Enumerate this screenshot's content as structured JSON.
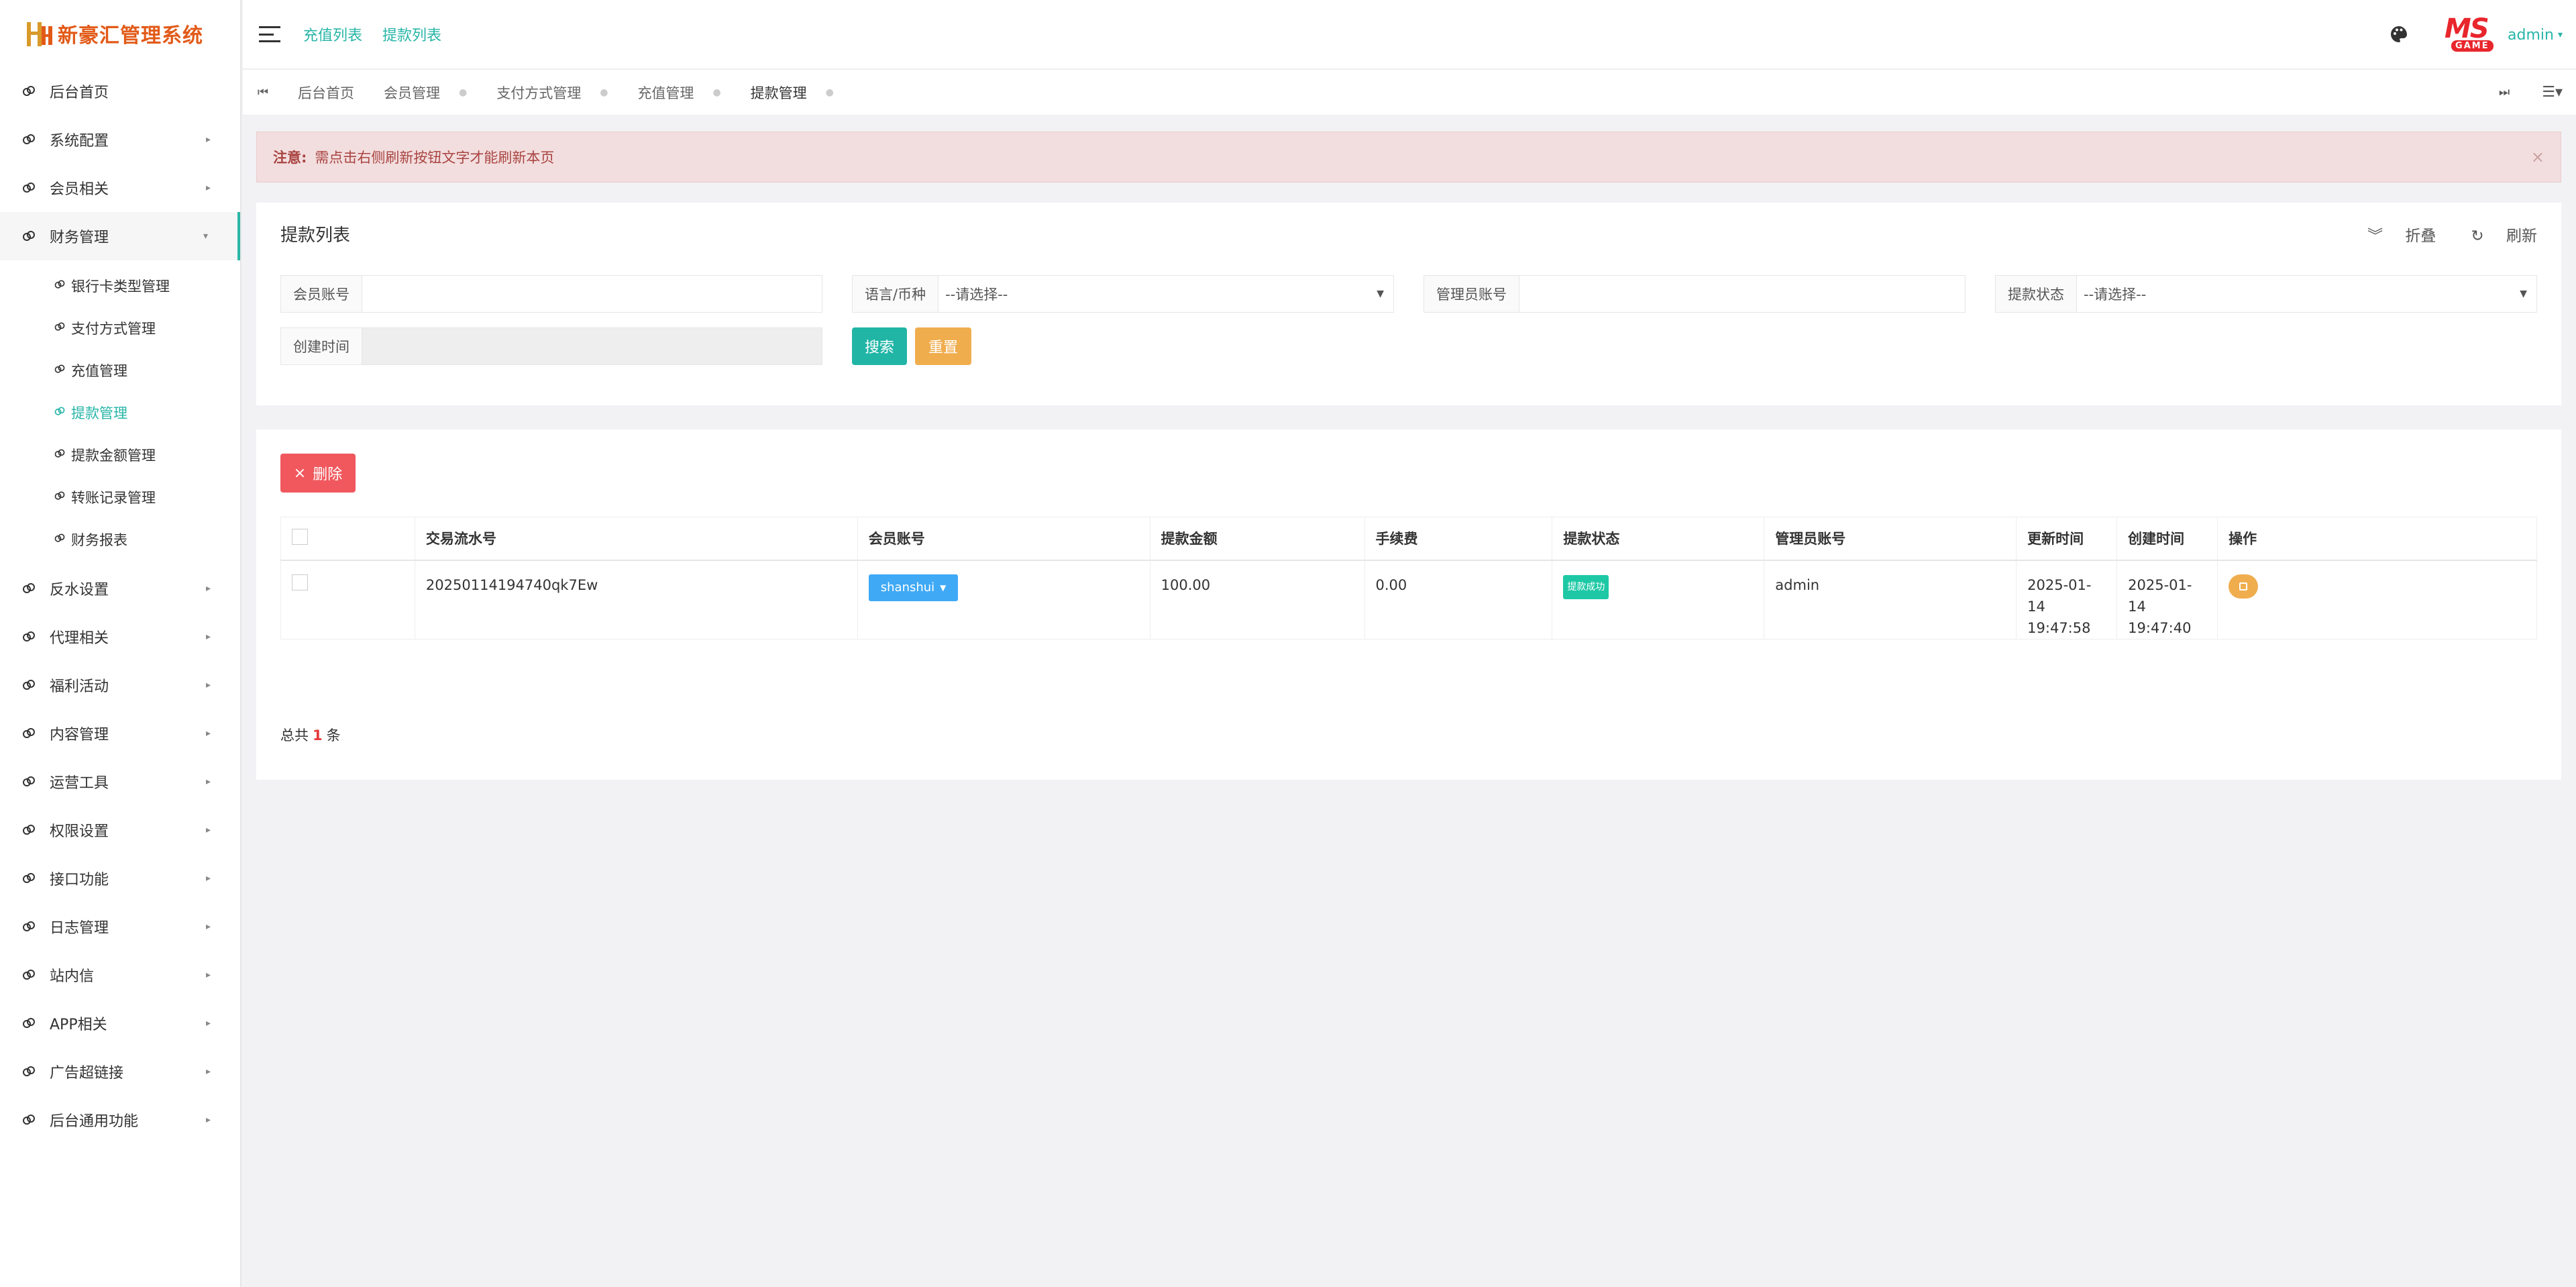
{
  "app": {
    "logo_text": "新豪汇管理系统"
  },
  "sidebar": {
    "items": [
      {
        "label": "后台首页",
        "has_children": false
      },
      {
        "label": "系统配置",
        "has_children": true
      },
      {
        "label": "会员相关",
        "has_children": true
      },
      {
        "label": "财务管理",
        "has_children": true,
        "open": true
      }
    ],
    "finance_children": [
      {
        "label": "银行卡类型管理"
      },
      {
        "label": "支付方式管理"
      },
      {
        "label": "充值管理"
      },
      {
        "label": "提款管理",
        "active": true
      },
      {
        "label": "提款金额管理"
      },
      {
        "label": "转账记录管理"
      },
      {
        "label": "财务报表"
      }
    ],
    "items_after": [
      {
        "label": "反水设置"
      },
      {
        "label": "代理相关"
      },
      {
        "label": "福利活动"
      },
      {
        "label": "内容管理"
      },
      {
        "label": "运营工具"
      },
      {
        "label": "权限设置"
      },
      {
        "label": "接口功能"
      },
      {
        "label": "日志管理"
      },
      {
        "label": "站内信"
      },
      {
        "label": "APP相关"
      },
      {
        "label": "广告超链接"
      },
      {
        "label": "后台通用功能"
      }
    ]
  },
  "topbar": {
    "links": [
      "充值列表",
      "提款列表"
    ],
    "brand_ms": "MS",
    "brand_game": "GAME",
    "user": "admin"
  },
  "tabs": [
    {
      "label": "后台首页"
    },
    {
      "label": "会员管理"
    },
    {
      "label": "支付方式管理"
    },
    {
      "label": "充值管理"
    },
    {
      "label": "提款管理",
      "active": true
    }
  ],
  "alert": {
    "prefix": "注意:",
    "message": "需点击右侧刷新按钮文字才能刷新本页"
  },
  "filter_panel": {
    "title": "提款列表",
    "collapse_label": "折叠",
    "refresh_label": "刷新",
    "fields": {
      "member": {
        "label": "会员账号",
        "value": ""
      },
      "lang": {
        "label": "语言/币种",
        "value": "--请选择--"
      },
      "admin": {
        "label": "管理员账号",
        "value": ""
      },
      "status": {
        "label": "提款状态",
        "value": "--请选择--"
      },
      "created": {
        "label": "创建时间",
        "value": ""
      }
    },
    "search_label": "搜索",
    "reset_label": "重置"
  },
  "list_panel": {
    "delete_label": "删除",
    "columns": [
      "交易流水号",
      "会员账号",
      "提款金额",
      "手续费",
      "提款状态",
      "管理员账号",
      "更新时间",
      "创建时间",
      "操作"
    ],
    "rows": [
      {
        "serial": "20250114194740qk7Ew",
        "member": "shanshui",
        "amount": "100.00",
        "fee": "0.00",
        "status": "提款成功",
        "admin": "admin",
        "updated_date": "2025-01-14",
        "updated_time": "19:47:58",
        "created_date": "2025-01-14",
        "created_time": "19:47:40"
      }
    ],
    "total_prefix": "总共",
    "total_count": "1",
    "total_suffix": "条"
  }
}
